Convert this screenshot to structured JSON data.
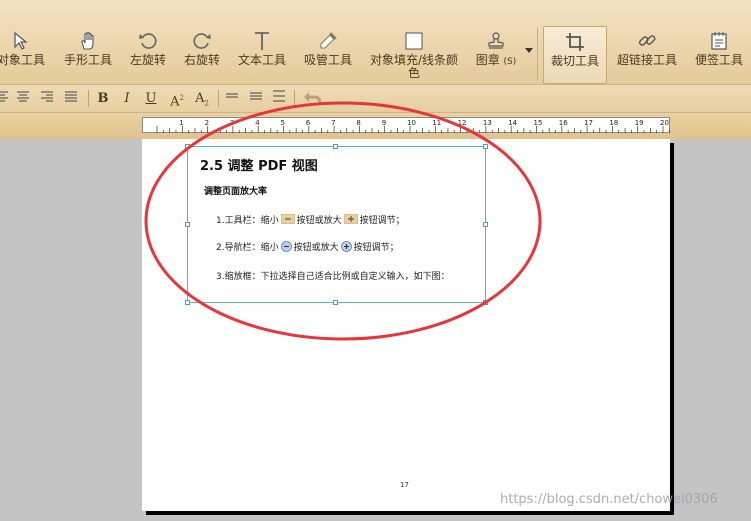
{
  "toolbar": {
    "tools": [
      {
        "label": "对象工具",
        "icon": "arrow-cursor-icon"
      },
      {
        "label": "手形工具",
        "icon": "hand-icon"
      },
      {
        "label": "左旋转",
        "icon": "rotate-left-icon"
      },
      {
        "label": "右旋转",
        "icon": "rotate-right-icon"
      },
      {
        "label": "文本工具",
        "icon": "text-t-icon"
      },
      {
        "label": "吸管工具",
        "icon": "eyedropper-icon"
      },
      {
        "label": "对象填充/线条颜",
        "label2": "色",
        "icon": "fill-box-icon"
      },
      {
        "label": "图章",
        "suffix": "(S)",
        "icon": "stamp-icon"
      },
      {
        "label": "裁切工具",
        "icon": "crop-icon"
      },
      {
        "label": "超链接工具",
        "icon": "link-icon"
      },
      {
        "label": "便签工具",
        "icon": "note-icon"
      }
    ],
    "active_tool": "裁切工具"
  },
  "format_bar": {
    "bold": "B",
    "italic": "I",
    "underline": "U",
    "superscript": "A",
    "superscript_mark": "2",
    "subscript": "A",
    "subscript_mark": "2"
  },
  "ruler": {
    "numbers": [
      "1",
      "2",
      "3",
      "4",
      "5",
      "6",
      "7",
      "8",
      "9",
      "10",
      "11",
      "12",
      "13",
      "14",
      "15",
      "16",
      "17",
      "18",
      "19",
      "20"
    ]
  },
  "document": {
    "title": "2.5 调整 PDF 视图",
    "subtitle": "调整页面放大率",
    "line1": {
      "pre": "1.工具栏：缩小",
      "mid": "按钮或放大",
      "post": "按钮调节；"
    },
    "line2": {
      "pre": "2.导航栏：缩小",
      "mid": "按钮或放大",
      "post": "按钮调节；"
    },
    "line3": "3.缩放框：下拉选择自己适合比例或自定义输入，如下图：",
    "page_number": "17"
  },
  "watermark": "https://blog.csdn.net/chowei0306",
  "colors": {
    "annotation_ellipse": "#e8353a",
    "selection_border": "#4fb6c6",
    "toolbar_bg": "#ecd7ad"
  }
}
